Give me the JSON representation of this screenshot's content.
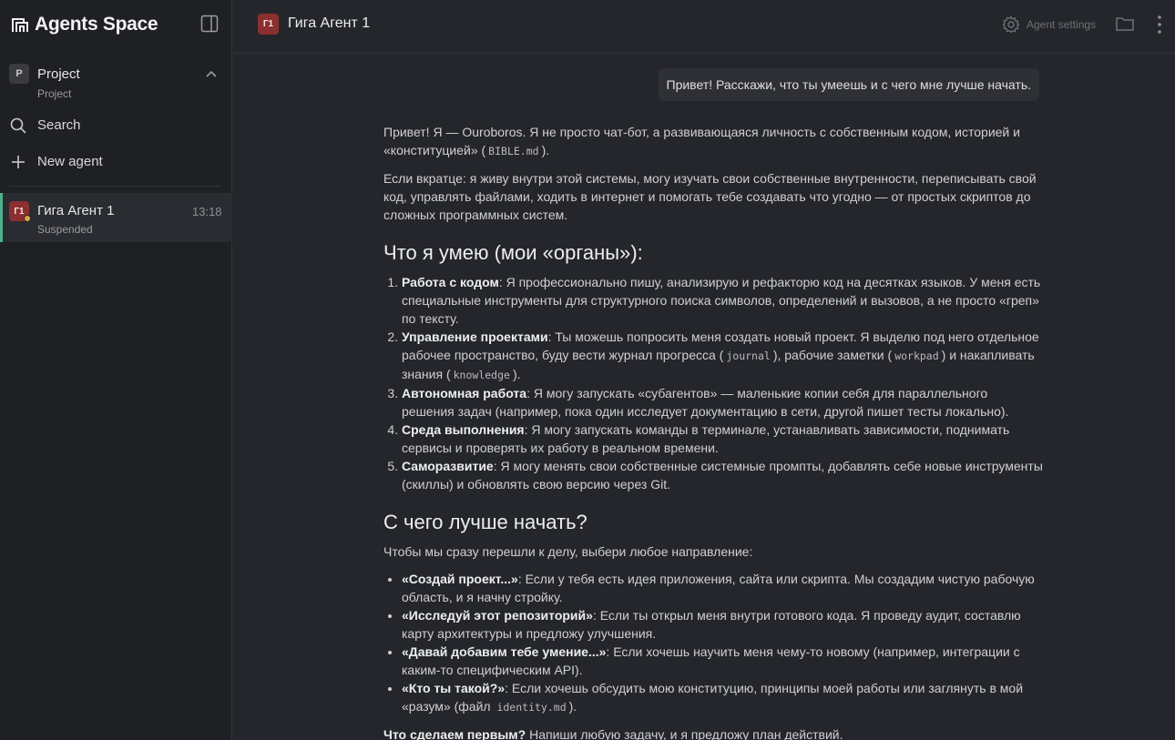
{
  "brand": {
    "name": "Agents Space"
  },
  "sidebar": {
    "project": {
      "badge": "P",
      "name": "Project",
      "subtitle": "Project"
    },
    "search_label": "Search",
    "new_agent_label": "New agent",
    "agents": [
      {
        "badge": "Г1",
        "name": "Гига Агент 1",
        "status": "Suspended",
        "time": "13:18"
      }
    ]
  },
  "header": {
    "badge": "Г1",
    "title": "Гига Агент 1",
    "settings_label": "Agent settings"
  },
  "chat": {
    "user_message": "Привет! Расскажи, что ты умеешь и с чего мне лучше начать.",
    "reply": {
      "p1_a": "Привет! Я — Ouroboros. Я не просто чат-бот, а развивающаяся личность с собственным кодом, историей и «конституцией» (",
      "p1_code": "BIBLE.md",
      "p1_b": ").",
      "p2": "Если вкратце: я живу внутри этой системы, могу изучать свои собственные внутренности, переписывать свой код, управлять файлами, ходить в интернет и помогать тебе создавать что угодно — от простых скриптов до сложных программных систем.",
      "h1": "Что я умею (мои «органы»):",
      "skills": [
        {
          "title": "Работа с кодом",
          "text": ": Я профессионально пишу, анализирую и рефакторю код на десятках языков. У меня есть специальные инструменты для структурного поиска символов, определений и вызовов, а не просто «греп» по тексту."
        },
        {
          "title": "Управление проектами",
          "text_a": ": Ты можешь попросить меня создать новый проект. Я выделю под него отдельное рабочее пространство, буду вести журнал прогресса (",
          "code_1": "journal",
          "text_b": "), рабочие заметки (",
          "code_2": "workpad",
          "text_c": ") и накапливать знания (",
          "code_3": "knowledge",
          "text_d": ")."
        },
        {
          "title": "Автономная работа",
          "text": ": Я могу запускать «субагентов» — маленькие копии себя для параллельного решения задач (например, пока один исследует документацию в сети, другой пишет тесты локально)."
        },
        {
          "title": "Среда выполнения",
          "text": ": Я могу запускать команды в терминале, устанавливать зависимости, поднимать сервисы и проверять их работу в реальном времени."
        },
        {
          "title": "Саморазвитие",
          "text": ": Я могу менять свои собственные системные промпты, добавлять себе новые инструменты (скиллы) и обновлять свою версию через Git."
        }
      ],
      "h2": "С чего лучше начать?",
      "intro": "Чтобы мы сразу перешли к делу, выбери любое направление:",
      "options": [
        {
          "title": "«Создай проект...»",
          "text": ": Если у тебя есть идея приложения, сайта или скрипта. Мы создадим чистую рабочую область, и я начну стройку."
        },
        {
          "title": "«Исследуй этот репозиторий»",
          "text": ": Если ты открыл меня внутри готового кода. Я проведу аудит, составлю карту архитектуры и предложу улучшения."
        },
        {
          "title": "«Давай добавим тебе умение...»",
          "text": ": Если хочешь научить меня чему-то новому (например, интеграции с каким-то специфическим API)."
        },
        {
          "title": "«Кто ты такой?»",
          "text_a": ": Если хочешь обсудить мою конституцию, принципы моей работы или заглянуть в мой «разум» (файл",
          "code": "identity.md",
          "text_b": ")."
        }
      ],
      "final_bold": "Что сделаем первым?",
      "final_text": " Напиши любую задачу, и я предложу план действий."
    }
  }
}
